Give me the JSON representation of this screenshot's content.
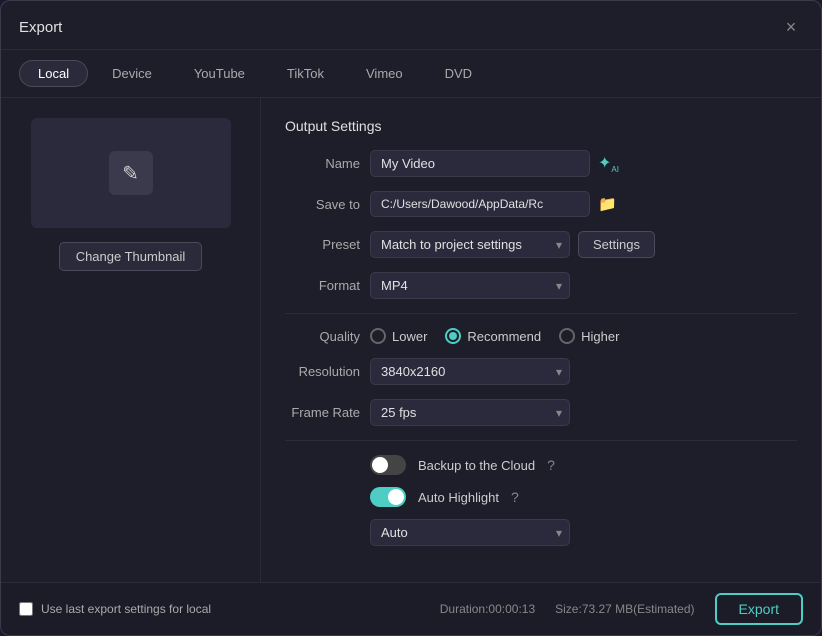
{
  "dialog": {
    "title": "Export",
    "close_label": "×"
  },
  "tabs": {
    "items": [
      {
        "label": "Local",
        "active": true
      },
      {
        "label": "Device",
        "active": false
      },
      {
        "label": "YouTube",
        "active": false
      },
      {
        "label": "TikTok",
        "active": false
      },
      {
        "label": "Vimeo",
        "active": false
      },
      {
        "label": "DVD",
        "active": false
      }
    ]
  },
  "thumbnail": {
    "change_label": "Change Thumbnail",
    "icon": "✎"
  },
  "output_settings": {
    "section_title": "Output Settings",
    "name_label": "Name",
    "name_value": "My Video",
    "save_to_label": "Save to",
    "save_to_value": "C:/Users/Dawood/AppData/Rc",
    "preset_label": "Preset",
    "preset_value": "Match to project settings",
    "settings_label": "Settings",
    "format_label": "Format",
    "format_value": "MP4",
    "quality_label": "Quality",
    "quality_options": [
      {
        "label": "Lower",
        "checked": false
      },
      {
        "label": "Recommend",
        "checked": true
      },
      {
        "label": "Higher",
        "checked": false
      }
    ],
    "resolution_label": "Resolution",
    "resolution_value": "3840x2160",
    "frame_rate_label": "Frame Rate",
    "frame_rate_value": "25 fps",
    "backup_label": "Backup to the Cloud",
    "backup_on": false,
    "auto_highlight_label": "Auto Highlight",
    "auto_highlight_on": true,
    "auto_value": "Auto"
  },
  "bottom_bar": {
    "checkbox_label": "Use last export settings for local",
    "duration_label": "Duration:00:00:13",
    "size_label": "Size:73.27 MB(Estimated)",
    "export_label": "Export"
  }
}
